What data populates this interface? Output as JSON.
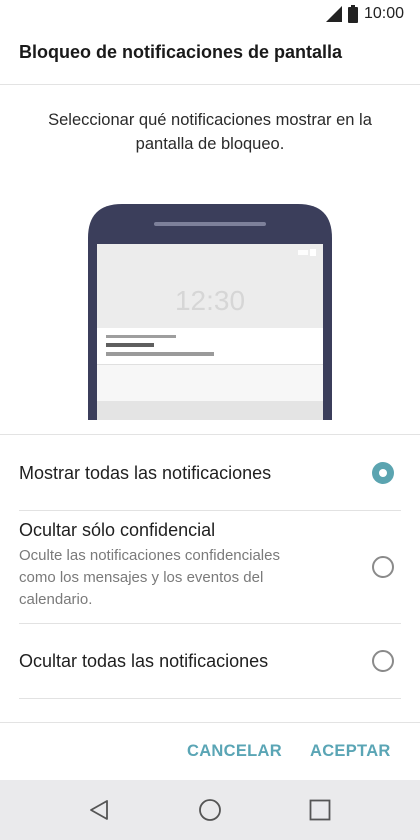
{
  "status_bar": {
    "time": "10:00"
  },
  "header": {
    "title": "Bloqueo de notificaciones de pantalla"
  },
  "description": "Seleccionar qué notificaciones mostrar en la pantalla de bloqueo.",
  "illustration": {
    "clock": "12:30"
  },
  "options": [
    {
      "title": "Mostrar todas las notificaciones",
      "subtitle": "",
      "selected": true
    },
    {
      "title": "Ocultar sólo confidencial",
      "subtitle": "Oculte las notificaciones confidenciales como los mensajes y los eventos del calendario.",
      "selected": false
    },
    {
      "title": "Ocultar todas las notificaciones",
      "subtitle": "",
      "selected": false
    }
  ],
  "buttons": {
    "cancel": "CANCELAR",
    "accept": "ACEPTAR"
  },
  "colors": {
    "accent": "#5aa5b5",
    "radio_selected": "#5ba4b0",
    "phone_frame": "#3b3e5b"
  },
  "icons": {
    "signal": "signal-icon",
    "battery": "battery-icon",
    "back": "back-icon",
    "home": "home-icon",
    "recents": "recents-icon"
  }
}
